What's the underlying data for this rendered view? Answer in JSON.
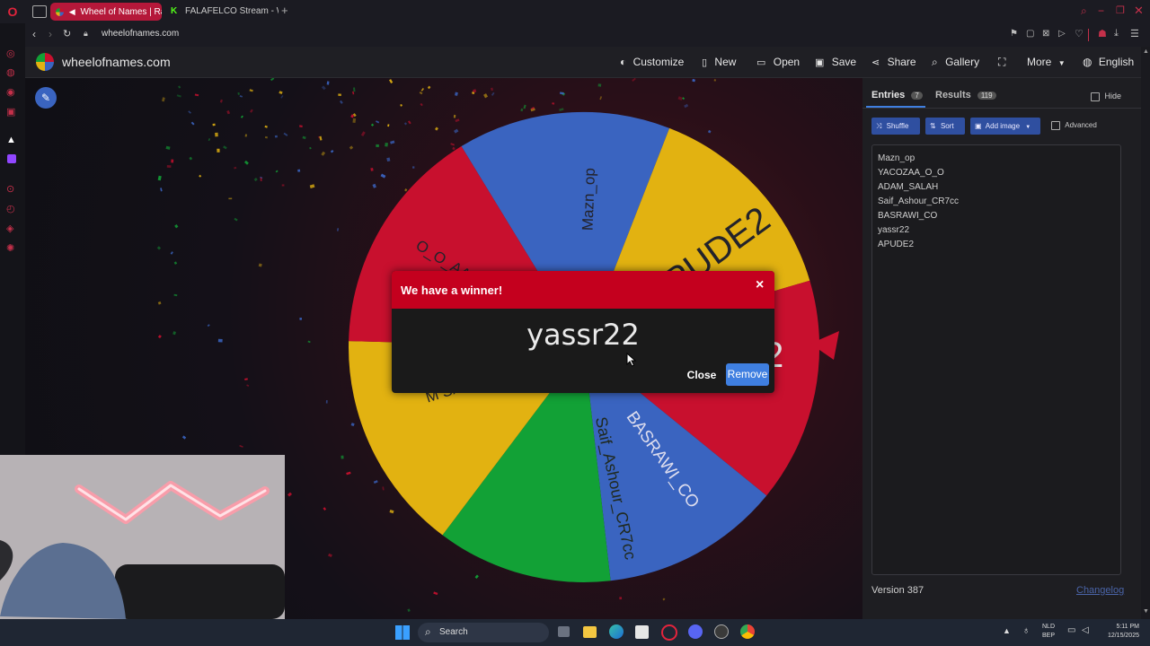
{
  "browser": {
    "tabs": [
      {
        "label": "Wheel of Names | Ra",
        "active": true
      },
      {
        "label": "FALAFELCO Stream - Wa",
        "active": false
      }
    ],
    "new_tab_symbol": "+",
    "url": "wheelofnames.com"
  },
  "site": {
    "logo_text": "wheelofnames.com",
    "nav": {
      "customize": "Customize",
      "new": "New",
      "open": "Open",
      "save": "Save",
      "share": "Share",
      "gallery": "Gallery",
      "more": "More",
      "language": "English"
    }
  },
  "wheel": {
    "colors": {
      "red": "#c8102e",
      "blue": "#3a64c0",
      "yellow": "#e2b211",
      "green": "#12a136"
    },
    "segments": [
      {
        "label": "Mazn_op",
        "color": "blue"
      },
      {
        "label": "APUDE2",
        "color": "yellow"
      },
      {
        "label": "yassr22",
        "color": "red"
      },
      {
        "label": "BASRAWI_CO",
        "color": "blue"
      },
      {
        "label": "Saif_Ashour_CR7cc",
        "color": "green"
      },
      {
        "label": "ADAM_SALAH",
        "color": "yellow"
      },
      {
        "label": "YACOZAA_O_O",
        "color": "red"
      }
    ],
    "visible_fragments": {
      "mazn": "Mazn_op",
      "apude": "APUDE2",
      "yassr_tail": "2",
      "basrawi": "BASRAWI_CO",
      "saif": "Saif_Ashour_CR7cc",
      "adam": "M SALAH",
      "yacozaa": "O_O_AAZ"
    }
  },
  "dialog": {
    "title": "We have a winner!",
    "close_x": "×",
    "winner": "yassr22",
    "close_label": "Close",
    "remove_label": "Remove"
  },
  "panel": {
    "tab_entries": "Entries",
    "entries_count": "7",
    "tab_results": "Results",
    "results_count": "119",
    "hide_label": "Hide",
    "shuffle_label": "Shuffle",
    "sort_label": "Sort",
    "add_image_label": "Add image",
    "advanced_label": "Advanced",
    "entries": [
      "Mazn_op",
      "YACOZAA_O_O",
      "ADAM_SALAH",
      "Saif_Ashour_CR7cc",
      "BASRAWI_CO",
      "yassr22",
      "APUDE2"
    ],
    "version": "Version 387",
    "changelog": "Changelog"
  },
  "taskbar": {
    "search_label": "Search",
    "lang_top": "NLD",
    "lang_bottom": "BEP",
    "time": "5:11 PM",
    "date": "12/15/2025"
  }
}
